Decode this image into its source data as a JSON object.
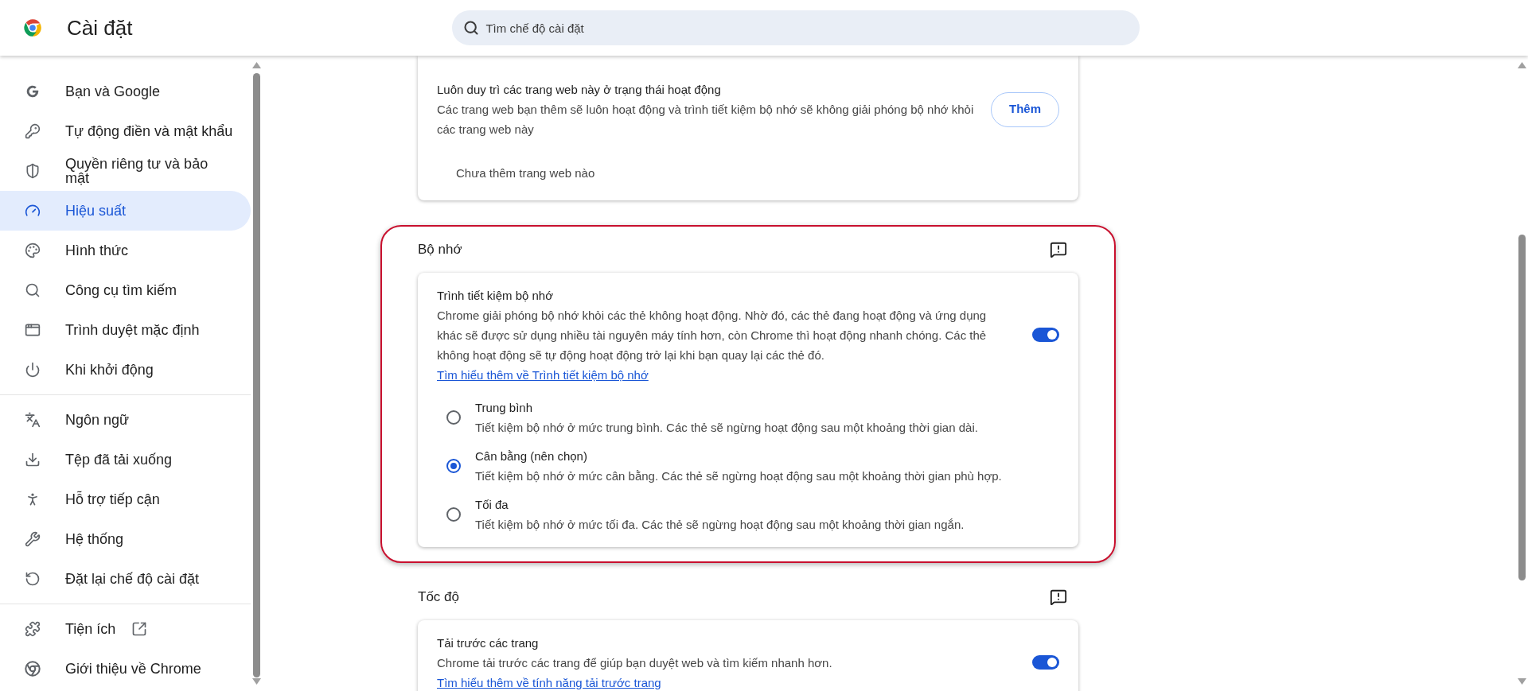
{
  "header": {
    "title": "Cài đặt",
    "search": {
      "placeholder": "Tìm chế độ cài đặt"
    }
  },
  "sidebar": {
    "groups": [
      [
        {
          "label": "Bạn và Google",
          "selected": false
        },
        {
          "label": "Tự động điền và mật khẩu",
          "selected": false
        },
        {
          "label": "Quyền riêng tư và bảo mật",
          "selected": false
        },
        {
          "label": "Hiệu suất",
          "selected": true
        },
        {
          "label": "Hình thức",
          "selected": false
        },
        {
          "label": "Công cụ tìm kiếm",
          "selected": false
        },
        {
          "label": "Trình duyệt mặc định",
          "selected": false
        },
        {
          "label": "Khi khởi động",
          "selected": false
        }
      ],
      [
        {
          "label": "Ngôn ngữ",
          "selected": false
        },
        {
          "label": "Tệp đã tải xuống",
          "selected": false
        },
        {
          "label": "Hỗ trợ tiếp cận",
          "selected": false
        },
        {
          "label": "Hệ thống",
          "selected": false
        },
        {
          "label": "Đặt lại chế độ cài đặt",
          "selected": false
        }
      ],
      [
        {
          "label": "Tiện ích",
          "selected": false,
          "external": true
        },
        {
          "label": "Giới thiệu về Chrome",
          "selected": false,
          "external": false
        }
      ]
    ]
  },
  "top_card": {
    "title": "Luôn duy trì các trang web này ở trạng thái hoạt động",
    "description": "Các trang web bạn thêm sẽ luôn hoạt động và trình tiết kiệm bộ nhớ sẽ không giải phóng bộ nhớ khỏi các trang web này",
    "button": "Thêm",
    "empty_text": "Chưa thêm trang web nào"
  },
  "sections": [
    {
      "title": "Bộ nhớ",
      "highlighted": true,
      "setting": {
        "title": "Trình tiết kiệm bộ nhớ",
        "description": "Chrome giải phóng bộ nhớ khỏi các thẻ không hoạt động. Nhờ đó, các thẻ đang hoạt động và ứng dụng khác sẽ được sử dụng nhiều tài nguyên máy tính hơn, còn Chrome thì hoạt động nhanh chóng. Các thẻ không hoạt động sẽ tự động hoạt động trở lại khi bạn quay lại các thẻ đó.",
        "link": "Tìm hiểu thêm về Trình tiết kiệm bộ nhớ",
        "on": true
      },
      "options": [
        {
          "label": "Trung bình",
          "description": "Tiết kiệm bộ nhớ ở mức trung bình. Các thẻ sẽ ngừng hoạt động sau một khoảng thời gian dài.",
          "selected": false
        },
        {
          "label": "Cân bằng (nên chọn)",
          "description": "Tiết kiệm bộ nhớ ở mức cân bằng. Các thẻ sẽ ngừng hoạt động sau một khoảng thời gian phù hợp.",
          "selected": true
        },
        {
          "label": "Tối đa",
          "description": "Tiết kiệm bộ nhớ ở mức tối đa. Các thẻ sẽ ngừng hoạt động sau một khoảng thời gian ngắn.",
          "selected": false
        }
      ]
    },
    {
      "title": "Tốc độ",
      "highlighted": false,
      "setting": {
        "title": "Tải trước các trang",
        "description": "Chrome tải trước các trang để giúp bạn duyệt web và tìm kiếm nhanh hơn.",
        "link": "Tìm hiểu thêm về tính năng tải trước trang",
        "on": true
      }
    }
  ]
}
